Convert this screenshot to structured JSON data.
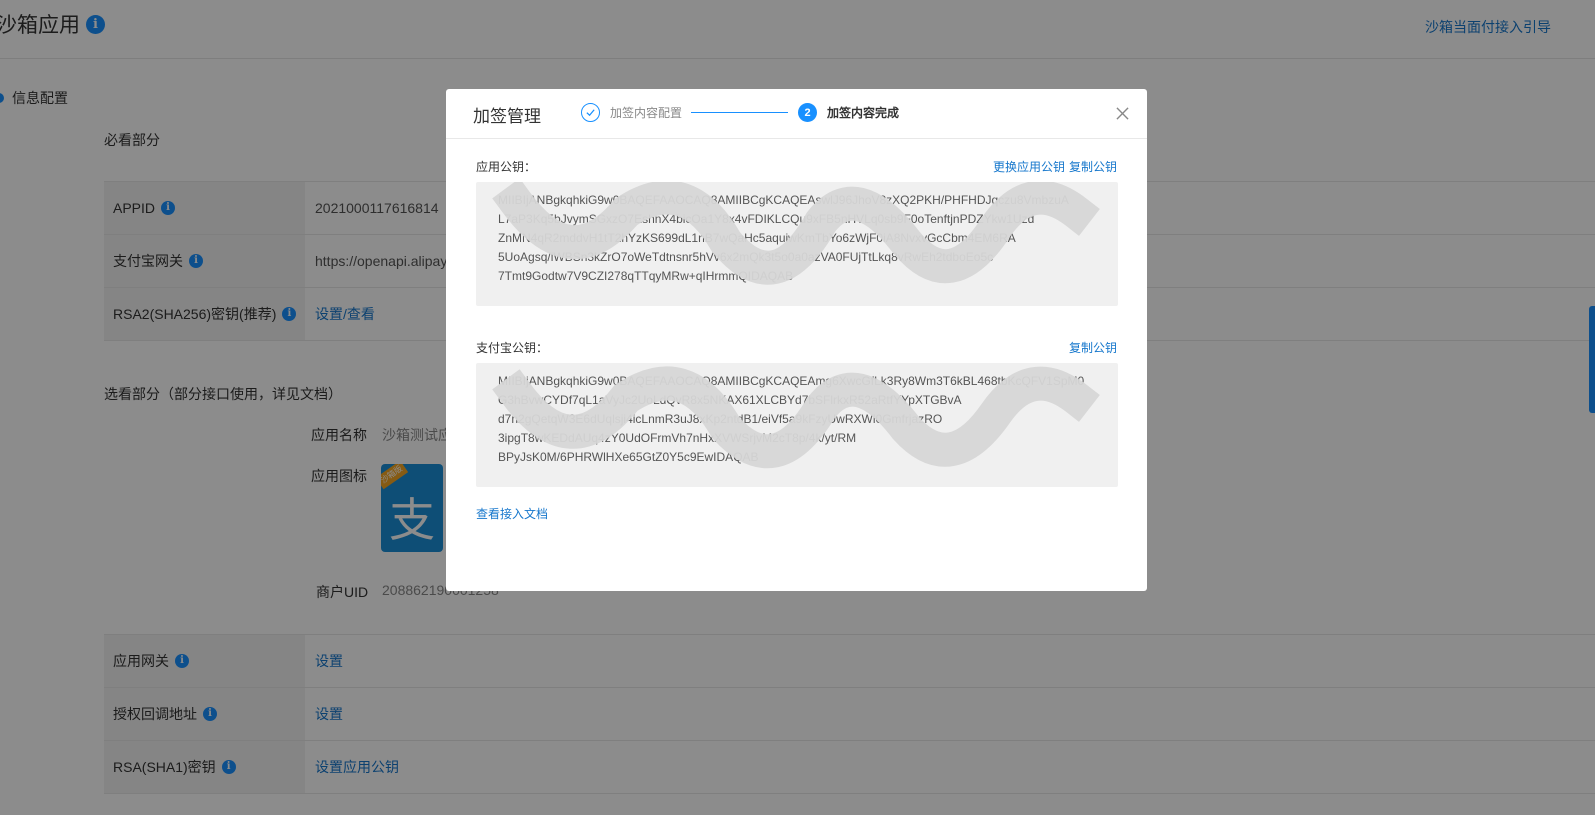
{
  "page": {
    "title": "沙箱应用",
    "guide_link": "沙箱当面付接入引导",
    "section_nav": "信息配置",
    "must_section": "必看部分",
    "optional_section": "选看部分（部分接口使用，详见文档）",
    "must_rows": [
      {
        "label": "APPID",
        "value": "2021000117616814"
      },
      {
        "label": "支付宝网关",
        "value": "https://openapi.alipay"
      },
      {
        "label": "RSA2(SHA256)密钥(推荐)",
        "value": "设置/查看"
      }
    ],
    "app_info": {
      "name_label": "应用名称",
      "name_value": "沙箱测试应",
      "icon_label": "应用图标",
      "uid_label": "商户UID",
      "uid_value": "208862190001258"
    },
    "bottom_rows": [
      {
        "label": "应用网关",
        "value": "设置"
      },
      {
        "label": "授权回调地址",
        "value": "设置"
      },
      {
        "label": "RSA(SHA1)密钥",
        "value": "设置应用公钥"
      }
    ],
    "app_icon_glyph": "支",
    "app_icon_tag": "沙箱版"
  },
  "modal": {
    "title": "加签管理",
    "steps": [
      {
        "label": "加签内容配置",
        "state": "done"
      },
      {
        "label": "加签内容完成",
        "number": "2",
        "state": "active"
      }
    ],
    "app_key": {
      "label": "应用公钥：",
      "actions": [
        "更换应用公钥",
        "复制公钥"
      ],
      "lines": [
        "MIIBIjANBgkqhkiG9w0BAQEFAAOCAQ8AMIIBCgKCAQEAswlJ96JhoV8zXQ2PKH/PHFHDJqczu8VmbzuA",
        "L7aP3Kq5bJvymSGxzO7EshnX4bicOa1Y8x4vFDIKLCQu9xFB5nHVLq0sb9F0oTenftjnPDZYkw1Uzd",
        "ZnMN4qR2mddvH1tT2hYzKS699dL1nB7wQaHc5aquiwKmTbYo6zWjF0iA8NvxvGcCbm4EM6RA",
        "5UoAgsq/iWBSn3kZrO7oWeTdtnsnr5hVv6x2mQk3t5o0a0azVA0FUjTtLkq8vRwEh2tdboEo5c",
        "7Tmt9Godtw7V9CZI278qTTqyMRw+qIHrmmQIDAQAB"
      ]
    },
    "alipay_key": {
      "label": "支付宝公钥：",
      "actions": [
        "复制公钥"
      ],
      "lines": [
        "MIIBIjANBgkqhkiG9w0BAQEFAAOCAQ8AMIIBCgKCAQEAmg6XwcGfLk3Ry8Wm3T6kBL468tbKcQFV1SpM0",
        "G3hBvwCYDf7qL1aVyJc2UoLdQvR8x5NKAX61XLCBYd7bSFlrkxR52aRtfYYpXTGBvA",
        "d7n2gQetqW3E6dUqlsji4icLnmR3uJ8xKp2ntdB1/eiVf5a9kFzyUwRXWl0GmfrjazRO",
        "3ipgT8wKEDdAUq4zY0UdOFrmVh7nHxXVWSrjvM2cT8p/4k/yt/RM",
        "BPyJsK0M/6PHRWlHXe65GtZ0Y5c9EwIDAQAB"
      ]
    },
    "doc_link": "查看接入文档"
  },
  "colors": {
    "accent": "#1890ff",
    "link": "#1677cc",
    "overlay": "rgba(0,0,0,0.45)"
  }
}
